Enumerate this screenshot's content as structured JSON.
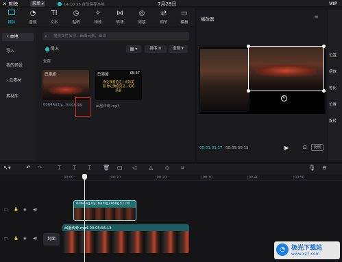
{
  "titlebar": {
    "app_name": "剪映",
    "menu_label": "菜单",
    "status_time": "14:10:35",
    "status_text": "自动保存本地",
    "project_title": "7月28日",
    "vip_label": "VIP"
  },
  "toolbar": {
    "items": [
      {
        "label": "媒体",
        "icon": "media-icon"
      },
      {
        "label": "音频",
        "icon": "audio-icon"
      },
      {
        "label": "文本",
        "icon": "text-icon"
      },
      {
        "label": "贴纸",
        "icon": "sticker-icon"
      },
      {
        "label": "特效",
        "icon": "effects-icon"
      },
      {
        "label": "转场",
        "icon": "transition-icon"
      },
      {
        "label": "滤镜",
        "icon": "filter-icon"
      },
      {
        "label": "调节",
        "icon": "adjust-icon"
      },
      {
        "label": "模板",
        "icon": "template-icon"
      }
    ],
    "active_index": 0
  },
  "leftnav": {
    "items": [
      "• 本地",
      "导入",
      "我的预设",
      "› 云素材",
      "素材库"
    ]
  },
  "media": {
    "search_placeholder": "搜索文件名称、画面元素、台词",
    "import_label": "导入",
    "sort_label": "排序 ≡",
    "all_label": "全部 ▾",
    "section_label": "全部",
    "cards": [
      {
        "badge": "已添加",
        "duration": "",
        "filename": "0064Ag1ly...mods.jpg"
      },
      {
        "badge": "已添加",
        "duration": "05:57",
        "filename": "凤凰传奇.mp4",
        "overlay_text": "你让我看见这一切的美丽 你让我看见这一切的美丽"
      }
    ]
  },
  "player": {
    "title": "播放器",
    "time_current": "00:01:01:17",
    "time_total": "00:05:56:13",
    "ratio_label": "比例"
  },
  "props": {
    "labels": [
      "位置",
      "缩放",
      "等比",
      "位置",
      "旋转"
    ]
  },
  "timeline": {
    "ruler_ticks": [
      "00:00",
      "|00:10",
      "|00:20",
      "|00:30",
      "|00:40",
      "|00:50"
    ],
    "track1_clip_label": "0064Ag1ly1haf0g2s68g311t0",
    "track2_clip_label": "凤凰传奇.mp4   00:05:56:13",
    "cover_label": "封面",
    "playhead_position": 0.08
  },
  "watermark": {
    "name": "极光下载站",
    "url": "www.xz7.com"
  },
  "colors": {
    "accent": "#1fc6c7",
    "highlight_box": "#e22b2b",
    "clip_fill": "#1d6e70"
  }
}
